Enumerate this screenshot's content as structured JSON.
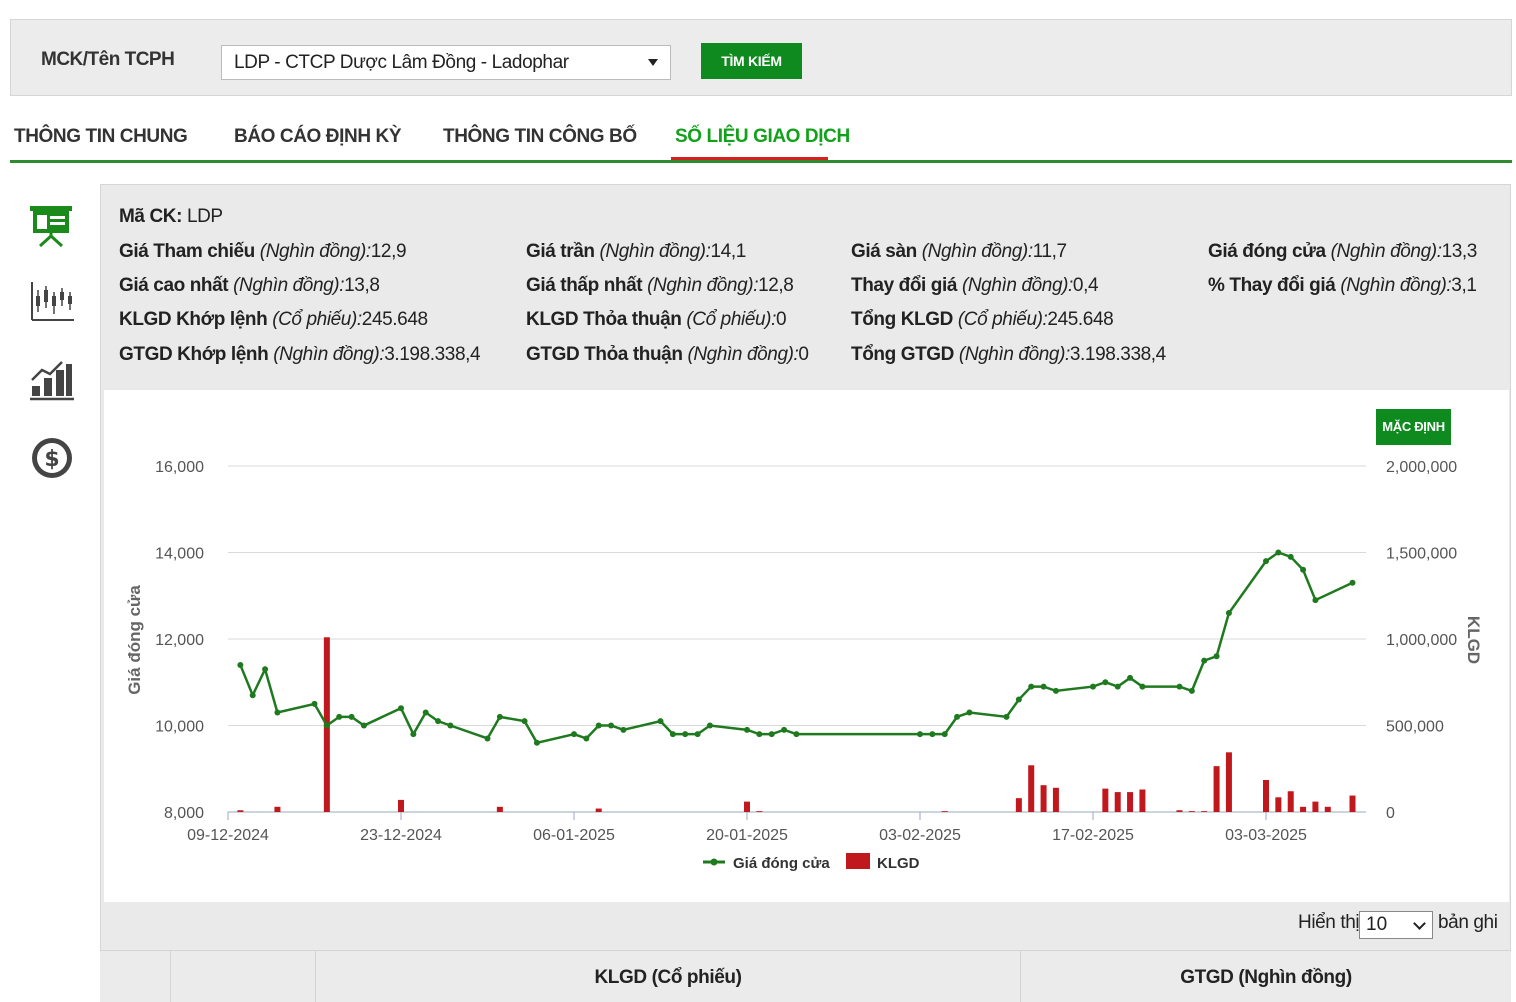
{
  "search": {
    "label": "MCK/Tên TCPH",
    "selected": "LDP - CTCP Dược Lâm Đồng - Ladophar",
    "button": "TÌM KIẾM"
  },
  "tabs": [
    {
      "label": "THÔNG TIN CHUNG",
      "active": false
    },
    {
      "label": "BÁO CÁO ĐỊNH KỲ",
      "active": false
    },
    {
      "label": "THÔNG TIN CÔNG BỐ",
      "active": false
    },
    {
      "label": "SỐ LIỆU GIAO DỊCH",
      "active": true
    }
  ],
  "side_icons": [
    "presentation-board-icon",
    "candlestick-chart-icon",
    "bar-growth-chart-icon",
    "dollar-coin-icon"
  ],
  "info": {
    "code_label": "Mã CK:",
    "code_value": "LDP",
    "rows": [
      [
        {
          "label": "Giá Tham chiếu",
          "unit": "(Nghìn đồng):",
          "value": "12,9"
        },
        {
          "label": "Giá trần",
          "unit": "(Nghìn đồng):",
          "value": "14,1"
        },
        {
          "label": "Giá sàn",
          "unit": "(Nghìn đồng):",
          "value": "11,7"
        },
        {
          "label": "Giá đóng cửa",
          "unit": "(Nghìn đồng):",
          "value": "13,3"
        }
      ],
      [
        {
          "label": "Giá cao nhất",
          "unit": "(Nghìn đồng):",
          "value": "13,8"
        },
        {
          "label": "Giá thấp nhất",
          "unit": "(Nghìn đồng):",
          "value": "12,8"
        },
        {
          "label": "Thay đổi giá",
          "unit": "(Nghìn đồng):",
          "value": "0,4"
        },
        {
          "label": "% Thay đổi giá",
          "unit": "(Nghìn đồng):",
          "value": "3,1"
        }
      ],
      [
        {
          "label": "KLGD Khớp lệnh",
          "unit": "(Cổ phiếu):",
          "value": "245.648"
        },
        {
          "label": "KLGD Thỏa thuận",
          "unit": "(Cổ phiếu):",
          "value": "0"
        },
        {
          "label": "Tổng KLGD",
          "unit": "(Cổ phiếu):",
          "value": "245.648"
        }
      ],
      [
        {
          "label": "GTGD Khớp lệnh",
          "unit": "(Nghìn đồng):",
          "value": "3.198.338,4"
        },
        {
          "label": "GTGD Thỏa thuận",
          "unit": "(Nghìn đồng):",
          "value": "0"
        },
        {
          "label": "Tổng GTGD",
          "unit": "(Nghìn đồng):",
          "value": "3.198.338,4"
        }
      ]
    ]
  },
  "chart_button": "MẶC ĐỊNH",
  "chart_data": {
    "type": "line",
    "title": "",
    "ylabel": "Giá đóng cửa",
    "y2label": "KLGD",
    "ylim": [
      8000,
      16000
    ],
    "y2lim": [
      0,
      2000000
    ],
    "yticks": [
      "8,000",
      "10,000",
      "12,000",
      "14,000",
      "16,000"
    ],
    "y2ticks": [
      "0",
      "500,000",
      "1,000,000",
      "1,500,000",
      "2,000,000"
    ],
    "xticks": [
      "09-12-2024",
      "23-12-2024",
      "06-01-2025",
      "20-01-2025",
      "03-02-2025",
      "17-02-2025",
      "03-03-2025"
    ],
    "legend": [
      "Giá đóng cửa",
      "KLGD"
    ],
    "legend_position": "bottom",
    "grid": true,
    "colors": {
      "line": "#1f7a1f",
      "bar": "#c0181c"
    },
    "series": [
      {
        "name": "Giá đóng cửa",
        "kind": "line",
        "points": [
          [
            "2024-12-10",
            11400
          ],
          [
            "2024-12-11",
            10700
          ],
          [
            "2024-12-12",
            11300
          ],
          [
            "2024-12-13",
            10300
          ],
          [
            "2024-12-16",
            10500
          ],
          [
            "2024-12-17",
            10000
          ],
          [
            "2024-12-18",
            10200
          ],
          [
            "2024-12-19",
            10200
          ],
          [
            "2024-12-20",
            10000
          ],
          [
            "2024-12-23",
            10400
          ],
          [
            "2024-12-24",
            9800
          ],
          [
            "2024-12-25",
            10300
          ],
          [
            "2024-12-26",
            10100
          ],
          [
            "2024-12-27",
            10000
          ],
          [
            "2024-12-30",
            9700
          ],
          [
            "2024-12-31",
            10200
          ],
          [
            "2025-01-02",
            10100
          ],
          [
            "2025-01-03",
            9600
          ],
          [
            "2025-01-06",
            9800
          ],
          [
            "2025-01-07",
            9700
          ],
          [
            "2025-01-08",
            10000
          ],
          [
            "2025-01-09",
            10000
          ],
          [
            "2025-01-10",
            9900
          ],
          [
            "2025-01-13",
            10100
          ],
          [
            "2025-01-14",
            9800
          ],
          [
            "2025-01-15",
            9800
          ],
          [
            "2025-01-16",
            9800
          ],
          [
            "2025-01-17",
            10000
          ],
          [
            "2025-01-20",
            9900
          ],
          [
            "2025-01-21",
            9800
          ],
          [
            "2025-01-22",
            9800
          ],
          [
            "2025-01-23",
            9900
          ],
          [
            "2025-01-24",
            9800
          ],
          [
            "2025-02-03",
            9800
          ],
          [
            "2025-02-04",
            9800
          ],
          [
            "2025-02-05",
            9800
          ],
          [
            "2025-02-06",
            10200
          ],
          [
            "2025-02-07",
            10300
          ],
          [
            "2025-02-10",
            10200
          ],
          [
            "2025-02-11",
            10600
          ],
          [
            "2025-02-12",
            10900
          ],
          [
            "2025-02-13",
            10900
          ],
          [
            "2025-02-14",
            10800
          ],
          [
            "2025-02-17",
            10900
          ],
          [
            "2025-02-18",
            11000
          ],
          [
            "2025-02-19",
            10900
          ],
          [
            "2025-02-20",
            11100
          ],
          [
            "2025-02-21",
            10900
          ],
          [
            "2025-02-24",
            10900
          ],
          [
            "2025-02-25",
            10800
          ],
          [
            "2025-02-26",
            11500
          ],
          [
            "2025-02-27",
            11600
          ],
          [
            "2025-02-28",
            12600
          ],
          [
            "2025-03-03",
            13800
          ],
          [
            "2025-03-04",
            14000
          ],
          [
            "2025-03-05",
            13900
          ],
          [
            "2025-03-06",
            13600
          ],
          [
            "2025-03-07",
            12900
          ],
          [
            "2025-03-10",
            13300
          ]
        ]
      },
      {
        "name": "KLGD",
        "kind": "bar",
        "points": [
          [
            "2024-12-10",
            10000
          ],
          [
            "2024-12-13",
            30000
          ],
          [
            "2024-12-17",
            1010000
          ],
          [
            "2024-12-23",
            70000
          ],
          [
            "2024-12-31",
            30000
          ],
          [
            "2025-01-08",
            20000
          ],
          [
            "2025-01-20",
            60000
          ],
          [
            "2025-01-21",
            5000
          ],
          [
            "2025-02-05",
            5000
          ],
          [
            "2025-02-11",
            80000
          ],
          [
            "2025-02-12",
            270000
          ],
          [
            "2025-02-13",
            155000
          ],
          [
            "2025-02-14",
            140000
          ],
          [
            "2025-02-18",
            135000
          ],
          [
            "2025-02-19",
            115000
          ],
          [
            "2025-02-20",
            115000
          ],
          [
            "2025-02-21",
            130000
          ],
          [
            "2025-02-24",
            10000
          ],
          [
            "2025-02-25",
            5000
          ],
          [
            "2025-02-26",
            5000
          ],
          [
            "2025-02-27",
            265000
          ],
          [
            "2025-02-28",
            345000
          ],
          [
            "2025-03-03",
            185000
          ],
          [
            "2025-03-04",
            85000
          ],
          [
            "2025-03-05",
            120000
          ],
          [
            "2025-03-06",
            30000
          ],
          [
            "2025-03-07",
            60000
          ],
          [
            "2025-03-08",
            30000
          ],
          [
            "2025-03-10",
            95000
          ]
        ]
      }
    ]
  },
  "pagination": {
    "show_before": "Hiển thị",
    "show_value": "10",
    "show_after": "bản ghi"
  },
  "table": {
    "headers": [
      "",
      "",
      "KLGD (Cổ phiếu)",
      "GTGD (Nghìn đồng)"
    ]
  }
}
